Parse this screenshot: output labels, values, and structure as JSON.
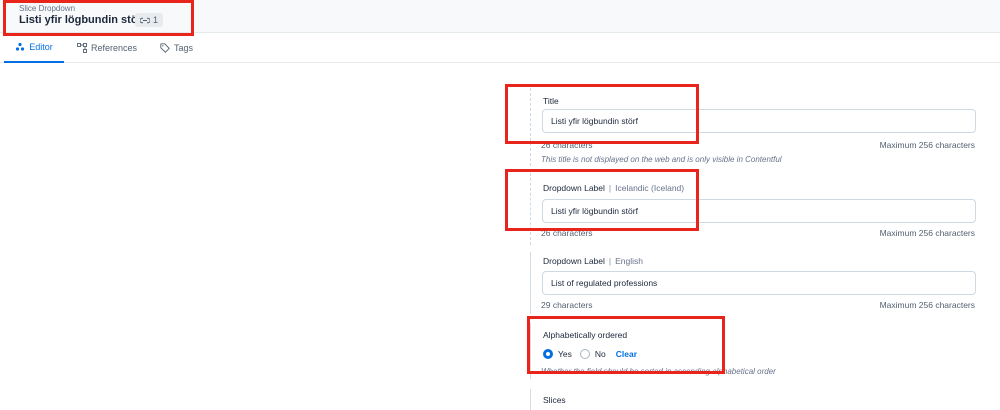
{
  "header": {
    "content_type": "Slice Dropdown",
    "entry_title": "Listi yfir lögbundin störf",
    "reference_count": "1",
    "reference_icon": "link-icon"
  },
  "tabs": [
    {
      "label": "Editor",
      "icon": "editor-icon",
      "active": true
    },
    {
      "label": "References",
      "icon": "references-icon",
      "active": false
    },
    {
      "label": "Tags",
      "icon": "tag-icon",
      "active": false
    }
  ],
  "fields": {
    "title": {
      "label": "Title",
      "value": "Listi yfir lögbundin störf",
      "counter": "26 characters",
      "max": "Maximum 256 characters",
      "help": "This title is not displayed on the web and is only visible in Contentful"
    },
    "dropdown_label_is": {
      "label": "Dropdown Label",
      "locale": "Icelandic (Iceland)",
      "value": "Listi yfir lögbundin störf",
      "counter": "26 characters",
      "max": "Maximum 256 characters"
    },
    "dropdown_label_en": {
      "label": "Dropdown Label",
      "locale": "English",
      "value": "List of regulated professions",
      "counter": "29 characters",
      "max": "Maximum 256 characters"
    },
    "alphabetical": {
      "label": "Alphabetically ordered",
      "yes": "Yes",
      "no": "No",
      "clear": "Clear",
      "selected": "Yes",
      "help": "Whether the field should be sorted in ascending alphabetical order"
    },
    "slices": {
      "label": "Slices"
    }
  },
  "colors": {
    "accent": "#036fe3",
    "highlight": "#e8241b"
  }
}
